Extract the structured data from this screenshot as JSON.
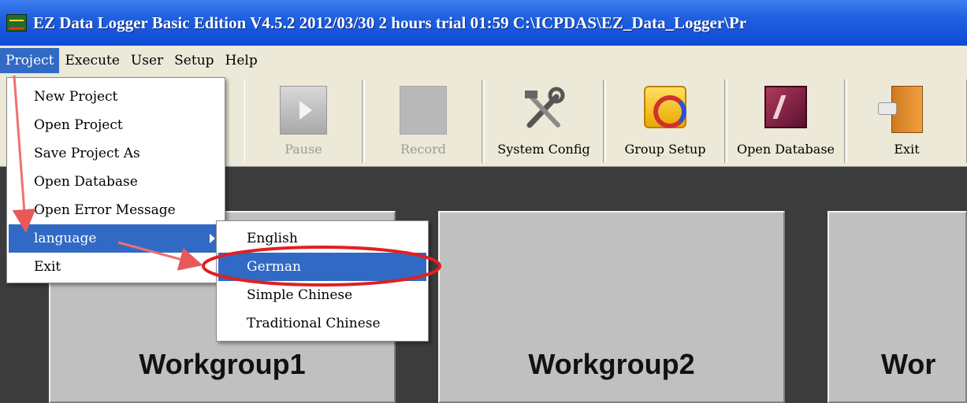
{
  "window": {
    "title": "EZ Data Logger Basic Edition V4.5.2 2012/03/30   2 hours trial  01:59  C:\\ICPDAS\\EZ_Data_Logger\\Pr"
  },
  "menubar": {
    "items": [
      "Project",
      "Execute",
      "User",
      "Setup",
      "Help"
    ]
  },
  "toolbar": {
    "pause_label": "Pause",
    "record_label": "Record",
    "system_config_label": "System Config",
    "group_setup_label": "Group Setup",
    "open_database_label": "Open Database",
    "exit_label": "Exit"
  },
  "project_menu": {
    "items": [
      "New Project",
      "Open Project",
      "Save Project As",
      "Open Database",
      "Open Error Message",
      "language",
      "Exit"
    ]
  },
  "language_menu": {
    "items": [
      "English",
      "German",
      "Simple Chinese",
      "Traditional Chinese"
    ],
    "selected": "German"
  },
  "workgroups": [
    "Workgroup1",
    "Workgroup2",
    "Wor"
  ],
  "colors": {
    "title_bar": "#0d4cd6",
    "highlight": "#316ac5",
    "annotation": "#e23030"
  }
}
